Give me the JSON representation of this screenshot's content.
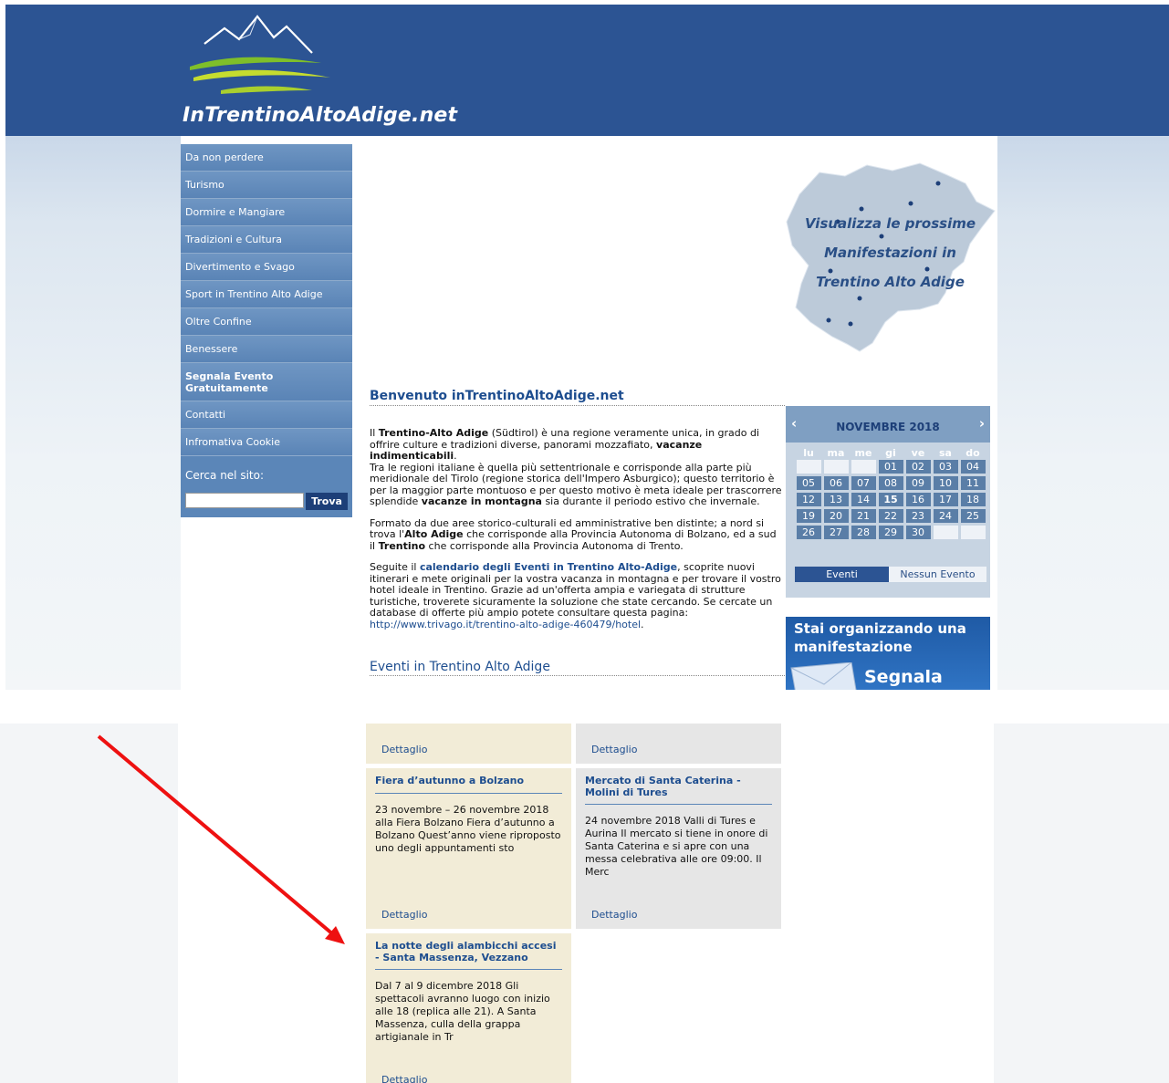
{
  "site": {
    "title": "InTrentinoAltoAdige.net"
  },
  "sidebar": {
    "items": [
      {
        "label": "Da non perdere"
      },
      {
        "label": "Turismo"
      },
      {
        "label": "Dormire e Mangiare"
      },
      {
        "label": "Tradizioni e Cultura"
      },
      {
        "label": "Divertimento e Svago"
      },
      {
        "label": "Sport in Trentino Alto Adige"
      },
      {
        "label": "Oltre Confine"
      },
      {
        "label": "Benessere"
      },
      {
        "label": "Segnala Evento Gratuitamente"
      },
      {
        "label": "Contatti"
      },
      {
        "label": "Infromativa Cookie"
      }
    ],
    "search": {
      "label": "Cerca nel sito:",
      "placeholder": "",
      "button": "Trova"
    }
  },
  "map": {
    "line1": "Visualizza le prossime",
    "line2": "Manifestazioni in",
    "line3": "Trentino Alto Adige"
  },
  "main": {
    "welcome_title": "Benvenuto inTrentinoAltoAdige.net",
    "p1": {
      "a": "Il ",
      "b": "Trentino-Alto Adige",
      "c": " (Südtirol) è una regione veramente unica, in grado di offrire culture e tradizioni diverse, panorami mozzafiato, ",
      "d": "vacanze indimenticabili",
      "e": ".",
      "f": "Tra le regioni italiane è quella più settentrionale e corrisponde alla parte più meridionale del Tirolo (regione storica dell'Impero Asburgico); questo territorio è per la maggior parte montuoso e per questo motivo è meta ideale per trascorrere splendide ",
      "g": "vacanze in montagna",
      "h": " sia durante il periodo estivo che invernale."
    },
    "p2": {
      "a": "Formato da due aree storico-culturali ed amministrative ben distinte;  a nord si trova l'",
      "b": "Alto Adige",
      "c": " che corrisponde alla Provincia Autonoma di Bolzano, ed a sud il ",
      "d": "Trentino",
      "e": " che corrisponde alla Provincia Autonoma di Trento."
    },
    "p3": {
      "a": "Seguite il ",
      "link": "calendario degli Eventi in Trentino Alto-Adige",
      "b": ", scoprite nuovi itinerari e mete originali per la vostra vacanza in montagna e per trovare il vostro hotel ideale in Trentino. Grazie ad un'offerta ampia e variegata di strutture turistiche, troverete sicuramente la soluzione che state cercando. Se cercate un database di offerte più ampio potete consultare questa pagina: ",
      "url": "http://www.trivago.it/trentino-alto-adige-460479/hotel",
      "c": "."
    },
    "events_title": "Eventi in Trentino Alto Adige"
  },
  "calendar": {
    "month": "NOVEMBRE 2018",
    "prev": "‹",
    "next": "›",
    "day_names": [
      "lu",
      "ma",
      "me",
      "gi",
      "ve",
      "sa",
      "do"
    ],
    "weeks": [
      [
        "",
        "",
        "",
        "01",
        "02",
        "03",
        "04"
      ],
      [
        "05",
        "06",
        "07",
        "08",
        "09",
        "10",
        "11"
      ],
      [
        "12",
        "13",
        "14",
        "15",
        "16",
        "17",
        "18"
      ],
      [
        "19",
        "20",
        "21",
        "22",
        "23",
        "24",
        "25"
      ],
      [
        "26",
        "27",
        "28",
        "29",
        "30",
        "",
        ""
      ]
    ],
    "today": "15",
    "legend_events": "Eventi",
    "legend_none": "Nessun Evento"
  },
  "banner": {
    "line1": "Stai organizzando una",
    "line2": "manifestazione",
    "line3": "Segnala"
  },
  "events": {
    "detail_label": "Dettaglio",
    "cards": [
      {
        "title": "Fiera d’autunno a Bolzano",
        "text": "23 novembre – 26 novembre 2018 alla Fiera Bolzano Fiera d’autunno a Bolzano Quest’anno viene riproposto uno degli appuntamenti sto"
      },
      {
        "title": "Mercato di Santa Caterina - Molini di Tures",
        "text": "24 novembre 2018 Valli di Tures e Aurina Il mercato si tiene in onore di Santa Caterina e si apre con una messa celebrativa alle ore 09:00. Il Merc"
      },
      {
        "title": "La notte degli alambicchi accesi - Santa Massenza, Vezzano",
        "text": "Dal 7 al 9 dicembre 2018 Gli spettacoli avranno luogo con inizio alle 18 (replica alle 21). A Santa Massenza, culla della grappa artigianale in Tr"
      }
    ]
  },
  "colors": {
    "header": "#2c5493",
    "accent": "#1d4d8f",
    "annotation_arrow": "#ee1111"
  }
}
